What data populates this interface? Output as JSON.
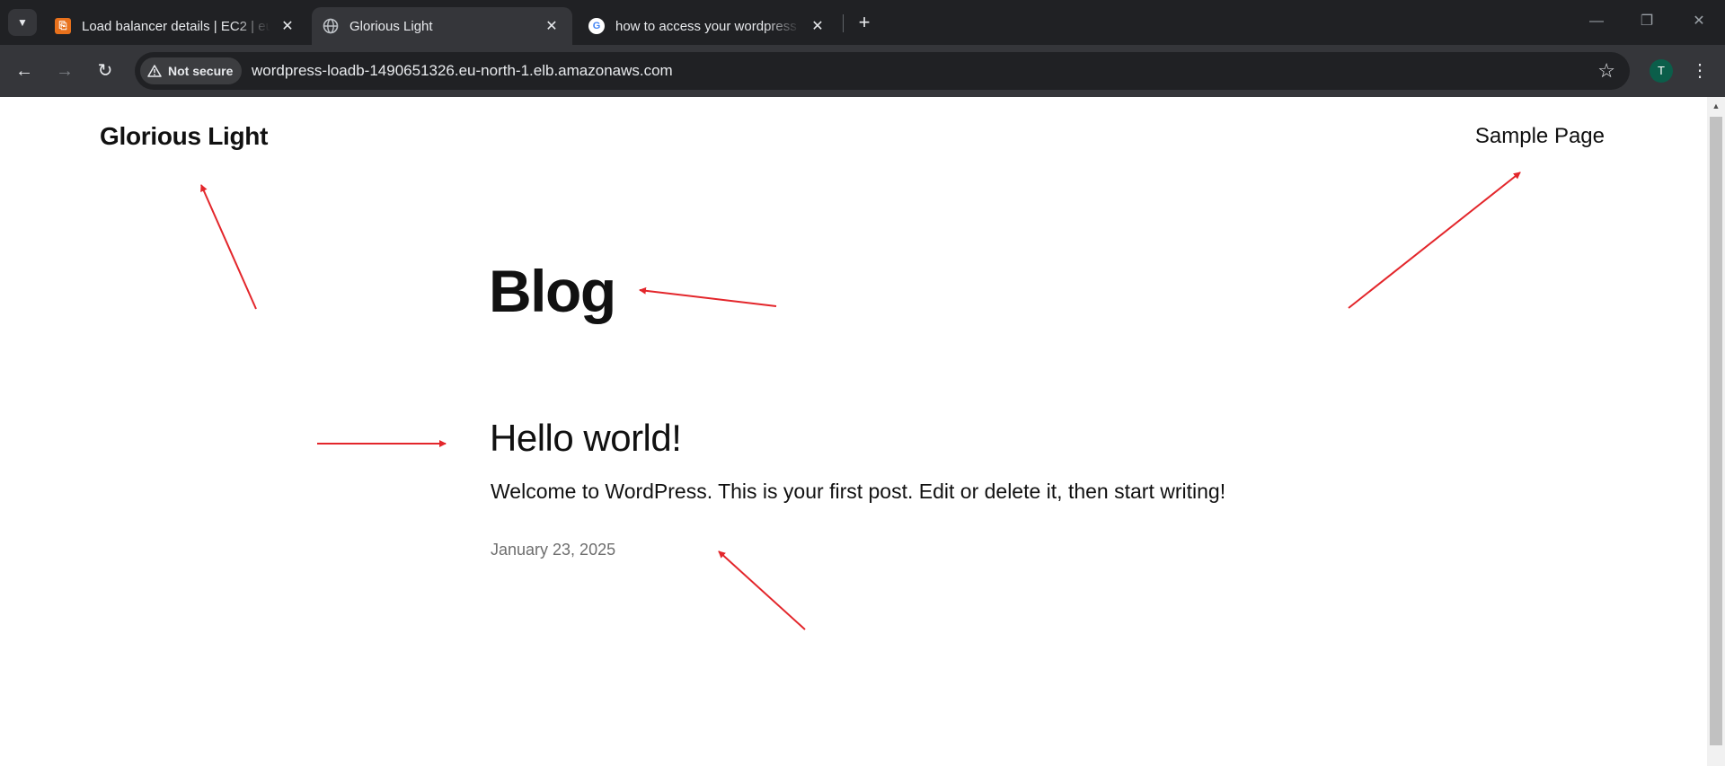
{
  "browser": {
    "tabs": [
      {
        "title": "Load balancer details | EC2 | eu",
        "active": false,
        "favicon": "aws-icon",
        "close": "✕"
      },
      {
        "title": "Glorious Light",
        "active": true,
        "favicon": "globe-icon",
        "close": "✕"
      },
      {
        "title": "how to access your wordpress s",
        "active": false,
        "favicon": "google-icon",
        "close": "✕"
      }
    ],
    "security_label": "Not secure",
    "url": "wordpress-loadb-1490651326.eu-north-1.elb.amazonaws.com",
    "profile_initial": "T",
    "colors": {
      "chrome_dark": "#202124",
      "chrome_mid": "#35363a",
      "annotation": "#e3262b",
      "profile": "#0b5e4a"
    }
  },
  "site": {
    "title": "Glorious Light",
    "nav": [
      "Sample Page"
    ]
  },
  "main": {
    "heading": "Blog",
    "post": {
      "title": "Hello world!",
      "excerpt": "Welcome to WordPress. This is your first post. Edit or delete it, then start writing!",
      "date": "January 23, 2025"
    }
  }
}
